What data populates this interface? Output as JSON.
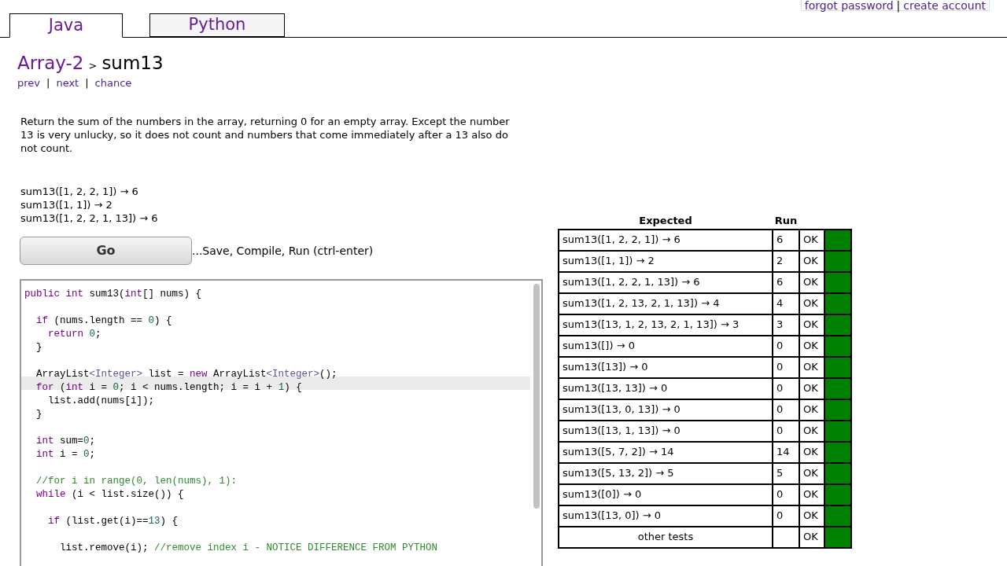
{
  "account_links": [
    {
      "label": "forgot password"
    },
    {
      "label": "create account"
    }
  ],
  "link_separator": "|",
  "tabs": [
    {
      "label": "Java",
      "selected": true
    },
    {
      "label": "Python",
      "selected": false
    }
  ],
  "breadcrumb": {
    "section": "Array-2",
    "separator": ">",
    "problem": "sum13"
  },
  "nav_links": [
    {
      "label": "prev"
    },
    {
      "label": "next"
    },
    {
      "label": "chance"
    }
  ],
  "description": "Return the sum of the numbers in the array, returning 0 for an empty array. Except the number 13 is very unlucky, so it does not count and numbers that come immediately after a 13 also do not count.",
  "examples": [
    "sum13([1, 2, 2, 1]) → 6",
    "sum13([1, 1]) → 2",
    "sum13([1, 2, 2, 1, 13]) → 6"
  ],
  "go_button": {
    "label": "Go",
    "hint": "...Save, Compile, Run (ctrl-enter)"
  },
  "editor": {
    "lines": [
      {
        "current": false,
        "tokens": [
          {
            "kind": "kw",
            "text": "public int"
          },
          {
            "kind": "plain",
            "text": " sum13("
          },
          {
            "kind": "kw",
            "text": "int"
          },
          {
            "kind": "plain",
            "text": "[] nums) {"
          }
        ]
      },
      {
        "current": false
      },
      {
        "current": false,
        "tokens": [
          {
            "kind": "kw",
            "text": "  if"
          },
          {
            "kind": "plain",
            "text": " (nums.length == "
          },
          {
            "kind": "num",
            "text": "0"
          },
          {
            "kind": "plain",
            "text": ") {"
          }
        ]
      },
      {
        "current": false,
        "tokens": [
          {
            "kind": "kw",
            "text": "    return "
          },
          {
            "kind": "num",
            "text": "0"
          },
          {
            "kind": "plain",
            "text": ";"
          }
        ]
      },
      {
        "current": false,
        "tokens": [
          {
            "kind": "plain",
            "text": "  }"
          }
        ]
      },
      {
        "current": false
      },
      {
        "current": false,
        "tokens": [
          {
            "kind": "plain",
            "text": "  ArrayList"
          },
          {
            "kind": "type",
            "text": "<Integer>"
          },
          {
            "kind": "plain",
            "text": " list = "
          },
          {
            "kind": "kw",
            "text": "new"
          },
          {
            "kind": "plain",
            "text": " ArrayList"
          },
          {
            "kind": "type",
            "text": "<Integer>"
          },
          {
            "kind": "plain",
            "text": "();"
          }
        ]
      },
      {
        "current": true,
        "tokens": [
          {
            "kind": "kw",
            "text": "  for"
          },
          {
            "kind": "plain",
            "text": " ("
          },
          {
            "kind": "kw",
            "text": "int"
          },
          {
            "kind": "plain",
            "text": " i = "
          },
          {
            "kind": "num",
            "text": "0"
          },
          {
            "kind": "plain",
            "text": "; i < nums.length; i = i + "
          },
          {
            "kind": "num",
            "text": "1"
          },
          {
            "kind": "plain",
            "text": ") {"
          }
        ]
      },
      {
        "current": false,
        "tokens": [
          {
            "kind": "plain",
            "text": "    list.add(nums[i]);"
          }
        ]
      },
      {
        "current": false,
        "tokens": [
          {
            "kind": "plain",
            "text": "  }"
          }
        ]
      },
      {
        "current": false
      },
      {
        "current": false,
        "tokens": [
          {
            "kind": "kw",
            "text": "  int"
          },
          {
            "kind": "plain",
            "text": " sum="
          },
          {
            "kind": "num",
            "text": "0"
          },
          {
            "kind": "plain",
            "text": ";"
          }
        ]
      },
      {
        "current": false,
        "tokens": [
          {
            "kind": "kw",
            "text": "  int"
          },
          {
            "kind": "plain",
            "text": " i = "
          },
          {
            "kind": "num",
            "text": "0"
          },
          {
            "kind": "plain",
            "text": ";"
          }
        ]
      },
      {
        "current": false
      },
      {
        "current": false,
        "tokens": [
          {
            "kind": "comment",
            "text": "  //for i in range(0, len(nums), 1):"
          }
        ]
      },
      {
        "current": false,
        "tokens": [
          {
            "kind": "kw",
            "text": "  while"
          },
          {
            "kind": "plain",
            "text": " (i < list.size()) {"
          }
        ]
      },
      {
        "current": false
      },
      {
        "current": false,
        "tokens": [
          {
            "kind": "kw",
            "text": "    if"
          },
          {
            "kind": "plain",
            "text": " (list.get(i)=="
          },
          {
            "kind": "num",
            "text": "13"
          },
          {
            "kind": "plain",
            "text": ") {"
          }
        ]
      },
      {
        "current": false
      },
      {
        "current": false,
        "tokens": [
          {
            "kind": "plain",
            "text": "      list.remove(i); "
          },
          {
            "kind": "comment",
            "text": "//remove index i - NOTICE DIFFERENCE FROM PYTHON"
          }
        ]
      }
    ]
  },
  "results": {
    "columns": [
      "Expected",
      "Run"
    ],
    "rows": [
      {
        "expected": "sum13([1, 2, 2, 1]) → 6",
        "run": "6",
        "status": "OK",
        "passed": true
      },
      {
        "expected": "sum13([1, 1]) → 2",
        "run": "2",
        "status": "OK",
        "passed": true
      },
      {
        "expected": "sum13([1, 2, 2, 1, 13]) → 6",
        "run": "6",
        "status": "OK",
        "passed": true
      },
      {
        "expected": "sum13([1, 2, 13, 2, 1, 13]) → 4",
        "run": "4",
        "status": "OK",
        "passed": true
      },
      {
        "expected": "sum13([13, 1, 2, 13, 2, 1, 13]) → 3",
        "run": "3",
        "status": "OK",
        "passed": true
      },
      {
        "expected": "sum13([]) → 0",
        "run": "0",
        "status": "OK",
        "passed": true
      },
      {
        "expected": "sum13([13]) → 0",
        "run": "0",
        "status": "OK",
        "passed": true
      },
      {
        "expected": "sum13([13, 13]) → 0",
        "run": "0",
        "status": "OK",
        "passed": true
      },
      {
        "expected": "sum13([13, 0, 13]) → 0",
        "run": "0",
        "status": "OK",
        "passed": true
      },
      {
        "expected": "sum13([13, 1, 13]) → 0",
        "run": "0",
        "status": "OK",
        "passed": true
      },
      {
        "expected": "sum13([5, 7, 2]) → 14",
        "run": "14",
        "status": "OK",
        "passed": true
      },
      {
        "expected": "sum13([5, 13, 2]) → 5",
        "run": "5",
        "status": "OK",
        "passed": true
      },
      {
        "expected": "sum13([0]) → 0",
        "run": "0",
        "status": "OK",
        "passed": true
      },
      {
        "expected": "sum13([13, 0]) → 0",
        "run": "0",
        "status": "OK",
        "passed": true
      },
      {
        "expected": "other tests",
        "status": "OK",
        "passed": true
      }
    ]
  }
}
